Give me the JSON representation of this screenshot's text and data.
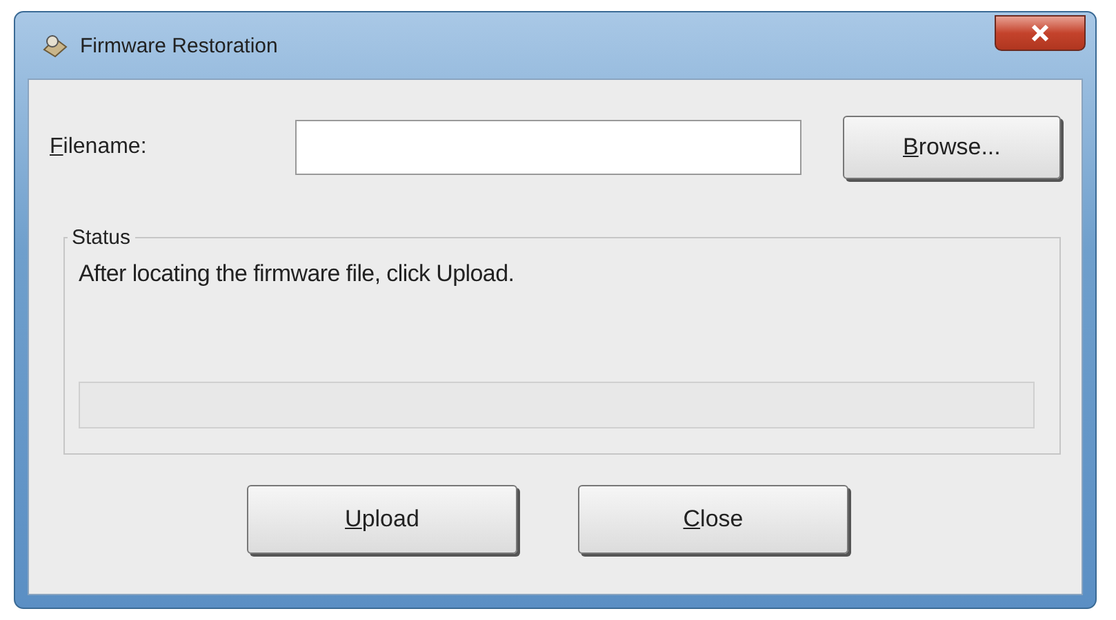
{
  "window": {
    "title": "Firmware Restoration"
  },
  "filename": {
    "label_key": "F",
    "label_rest": "ilename:"
  },
  "browse_button": {
    "label_key": "B",
    "label_rest": "rowse..."
  },
  "status": {
    "title": "Status",
    "message": "After locating the firmware file, click Upload.",
    "progress": {
      "level": 0
    }
  },
  "buttons": [
    {
      "label_key": "U",
      "label_rest": "pload"
    },
    {
      "label_key": "C",
      "label_rest": "lose"
    }
  ]
}
